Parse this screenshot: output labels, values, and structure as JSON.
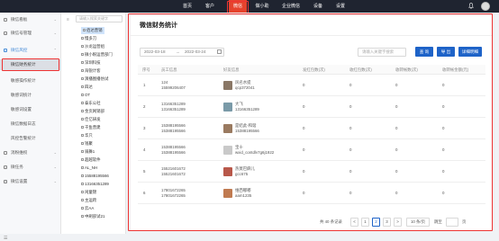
{
  "topnav": {
    "items": [
      "首页",
      "客户",
      "微信",
      "做小助",
      "企业微信",
      "设备",
      "设置"
    ],
    "active_index": 2
  },
  "sidebar": {
    "items": [
      {
        "label": "微信看板",
        "type": "parent"
      },
      {
        "label": "微信号管理",
        "type": "parent"
      },
      {
        "label": "微信风控",
        "type": "parent-open"
      },
      {
        "label": "微信财务统计",
        "type": "active"
      },
      {
        "label": "敏感操作统计",
        "type": "sub"
      },
      {
        "label": "敏感词统计",
        "type": "sub"
      },
      {
        "label": "敏感词设置",
        "type": "sub"
      },
      {
        "label": "微信数据日志",
        "type": "sub"
      },
      {
        "label": "风控告警统计",
        "type": "sub"
      },
      {
        "label": "消粉维权",
        "type": "parent"
      },
      {
        "label": "微任务",
        "type": "parent"
      },
      {
        "label": "微信设置",
        "type": "parent"
      }
    ]
  },
  "tree": {
    "search_placeholder": "请输入搜索关键字",
    "items": [
      "佰达营销",
      "慢多刀",
      "沙龙运营组",
      "微小盼运营部门",
      "深圳科技",
      "海锐计客",
      "演播图播仿试",
      "四达",
      "OT",
      "泰东公社",
      "金页网销部",
      "佳亿研发",
      "干鱼营建",
      "华只",
      "钱聚",
      "骑舞1",
      "超越软件",
      "AL_NH",
      "15588195566",
      "13166351289",
      "闲童锦",
      "主运跨",
      "云AA",
      "中刷部试21"
    ]
  },
  "page": {
    "title": "微信财务统计",
    "date_start": "2022-03-18",
    "date_sep": "→",
    "date_end": "2022-03-24",
    "keyword_placeholder": "请输入关键字搜索",
    "search_btn": "查 询",
    "export_btn": "导 出",
    "detail_btn": "详细明细"
  },
  "table": {
    "headers": [
      "序号",
      "员工信息",
      "好友信息",
      "发红包数(次)",
      "收红包数(次)",
      "收转帐数(次)",
      "收转帐金额(元)"
    ],
    "rows": [
      {
        "no": "1",
        "staff": [
          "124",
          "15599206407"
        ],
        "friend": [
          "风名水提",
          "qcp372041"
        ],
        "avatar_color": "#8a7766",
        "a": "0",
        "b": "0",
        "c": "0",
        "d": "0"
      },
      {
        "no": "2",
        "staff": [
          "13166351289",
          "13166351289"
        ],
        "friend": [
          "大飞",
          "13166351289"
        ],
        "avatar_color": "#7a9aa8",
        "a": "0",
        "b": "0",
        "c": "0",
        "d": "0"
      },
      {
        "no": "3",
        "staff": [
          "15388195566",
          "15388195566"
        ],
        "friend": [
          "是结此-和谐",
          "15388195566"
        ],
        "avatar_color": "#9a7a60",
        "a": "0",
        "b": "0",
        "c": "0",
        "d": "0"
      },
      {
        "no": "4",
        "staff": [
          "15388195566",
          "15388195566"
        ],
        "friend": [
          "宝十",
          "wxid_contdlv7g6j1922"
        ],
        "avatar_color": "#c9c9c9",
        "a": "0",
        "b": "0",
        "c": "0",
        "d": "0"
      },
      {
        "no": "5",
        "staff": [
          "15521601672",
          "15521601672"
        ],
        "friend": [
          "热莫巴麻儿",
          "gcc675"
        ],
        "avatar_color": "#b8584a",
        "a": "0",
        "b": "0",
        "c": "0",
        "d": "0"
      },
      {
        "no": "6",
        "staff": [
          "17801672265",
          "17801672265"
        ],
        "friend": [
          "维西嘟嘟",
          "aam1235"
        ],
        "avatar_color": "#c07a50",
        "a": "0",
        "b": "0",
        "c": "0",
        "d": "0"
      }
    ]
  },
  "pagination": {
    "total": "共 40 条记录",
    "pages": [
      "1",
      "2",
      "3"
    ],
    "current": "2",
    "prev": "<",
    "next": ">",
    "page_size": "10 条/页",
    "goto": "跳至",
    "page_unit": "页"
  },
  "colors": {
    "accent": "#1e63c8",
    "highlight": "#e33333",
    "nav_active": "#e6432d"
  }
}
